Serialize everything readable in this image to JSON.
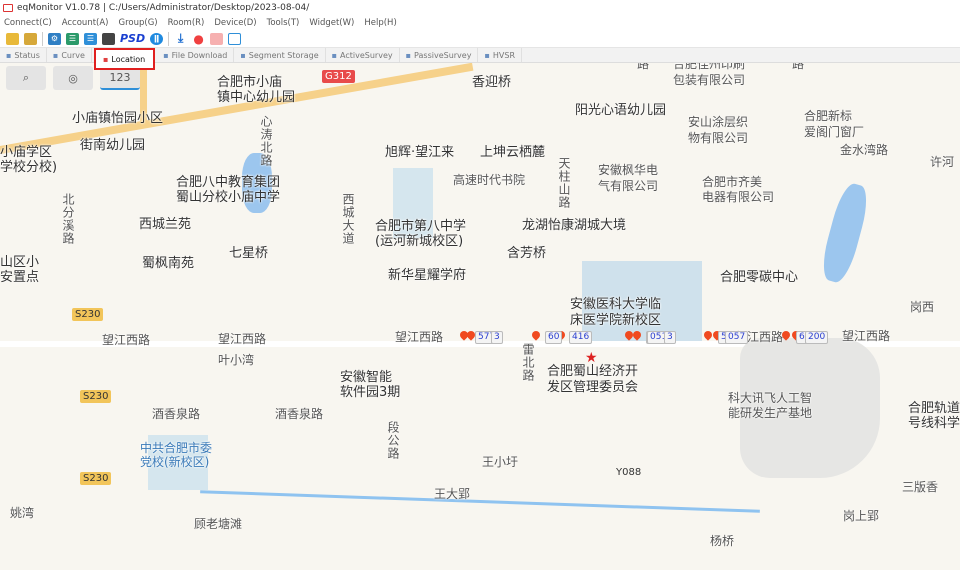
{
  "window": {
    "title": "eqMonitor V1.0.78 | C:/Users/Administrator/Desktop/2023-08-04/"
  },
  "menu": [
    "Connect(C)",
    "Account(A)",
    "Group(G)",
    "Room(R)",
    "Device(D)",
    "Tools(T)",
    "Widget(W)",
    "Help(H)"
  ],
  "toolbar": {
    "psd_label": "PSD",
    "icons": [
      "open-folder-icon",
      "folder-settings-icon",
      "gear-icon",
      "checklist-green-icon",
      "checklist-blue-icon",
      "monitor-icon",
      "psd-icon",
      "pause-icon",
      "download-icon",
      "location-pin-icon",
      "alarm-icon",
      "screen-icon"
    ]
  },
  "tabs": [
    "Status",
    "Curve",
    "Location",
    "File Download",
    "Segment Storage",
    "ActiveSurvey",
    "PassiveSurvey",
    "HVSR"
  ],
  "active_tab": "Location",
  "map_controls": {
    "layer_label": "123"
  },
  "map": {
    "labels": [
      "合肥市小庙",
      "镇中心幼儿园",
      "香迎桥",
      "合肥佳州印刷",
      "包装有限公司",
      "小庙镇怡园小区",
      "心涛北路",
      "阳光心语幼儿园",
      "安山涂层织",
      "物有限公司",
      "合肥新标",
      "爱阁门窗厂",
      "金水湾路",
      "街南幼儿园",
      "旭辉·望江来",
      "上坤云栖麓",
      "小庙学区",
      "学校分校)",
      "许河",
      "高速时代书院",
      "天柱山路",
      "安徽枫华电",
      "气有限公司",
      "合肥市齐美",
      "电器有限公司",
      "合肥八中教育集团",
      "蜀山分校小庙中学",
      "北分溪路",
      "西城大道",
      "西城兰苑",
      "合肥市第八中学",
      "(运河新城校区)",
      "龙湖怡康湖城大境",
      "蜀枫南苑",
      "七星桥",
      "含芳桥",
      "合肥零碳中心",
      "新华星耀学府",
      "山区小",
      "安置点",
      "安徽医科大学临",
      "床医学院新校区",
      "岗西",
      "望江西路",
      "望江西路",
      "望江西路",
      "望江西路",
      "望江西路",
      "叶小湾",
      "雷北路",
      "合肥蜀山经济开",
      "发区管理委员会",
      "安徽智能",
      "软件园3期",
      "科大讯飞人工智",
      "能研发生产基地",
      "合肥轨道",
      "号线科学城",
      "酒香泉路",
      "酒香泉路",
      "段公路",
      "中共合肥市委",
      "党校(新校区)",
      "王小圩",
      "王大郢",
      "三版香",
      "姚湾",
      "顾老塘滩",
      "岗上郢",
      "杨桥",
      "路",
      "路"
    ],
    "road_badges": [
      "G312",
      "S230",
      "S230",
      "S230",
      "Y088"
    ],
    "markers": [
      "577",
      "3",
      "60",
      "416",
      "50",
      "051",
      "3",
      "59",
      "057",
      "6",
      "200"
    ]
  }
}
